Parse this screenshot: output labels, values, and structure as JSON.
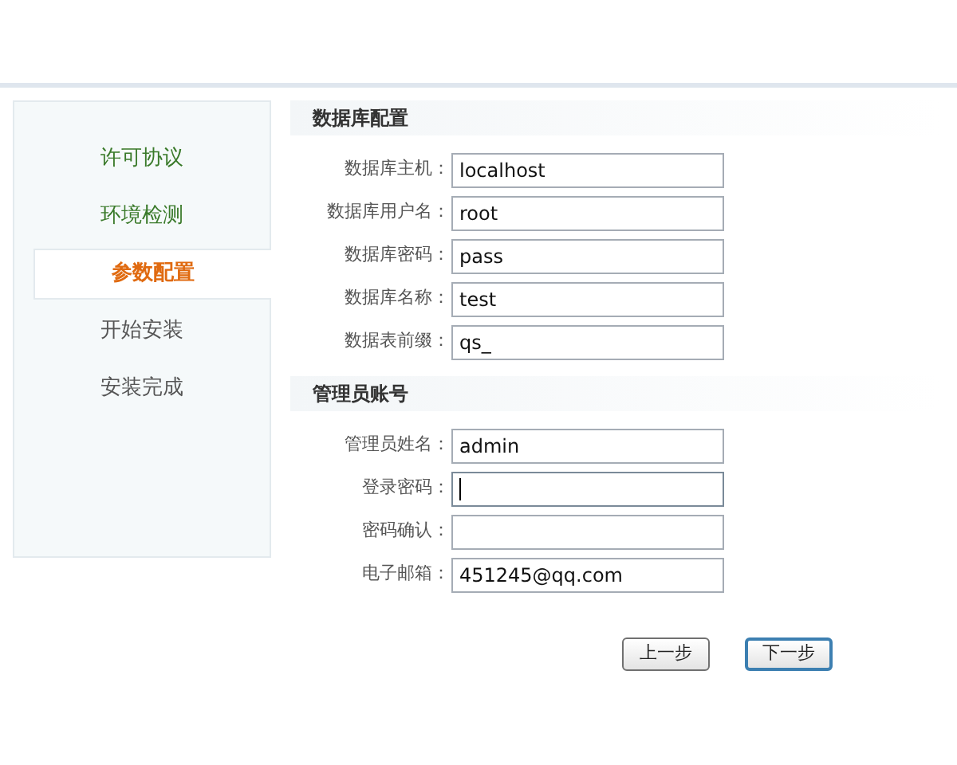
{
  "steps": [
    {
      "label": "许可协议",
      "done": true,
      "selected": false
    },
    {
      "label": "环境检测",
      "done": true,
      "selected": false
    },
    {
      "label": "参数配置",
      "done": false,
      "selected": true
    },
    {
      "label": "开始安装",
      "done": false,
      "selected": false
    },
    {
      "label": "安装完成",
      "done": false,
      "selected": false
    }
  ],
  "sections": [
    {
      "title": "数据库配置",
      "fields": [
        {
          "label": "数据库主机：",
          "value": "localhost",
          "focused": false
        },
        {
          "label": "数据库用户名：",
          "value": "root",
          "focused": false
        },
        {
          "label": "数据库密码：",
          "value": "pass",
          "focused": false
        },
        {
          "label": "数据库名称：",
          "value": "test",
          "focused": false
        },
        {
          "label": "数据表前缀：",
          "value": "qs_",
          "focused": false
        }
      ]
    },
    {
      "title": "管理员账号",
      "fields": [
        {
          "label": "管理员姓名：",
          "value": "admin",
          "focused": false
        },
        {
          "label": "登录密码：",
          "focused": true
        },
        {
          "label": "密码确认：",
          "focused": false
        },
        {
          "label": "电子邮箱：",
          "value": "451245@qq.com",
          "focused": false
        }
      ]
    }
  ],
  "buttons": [
    {
      "label": "上一步",
      "default": false
    },
    {
      "label": "下一步",
      "default": true
    }
  ]
}
